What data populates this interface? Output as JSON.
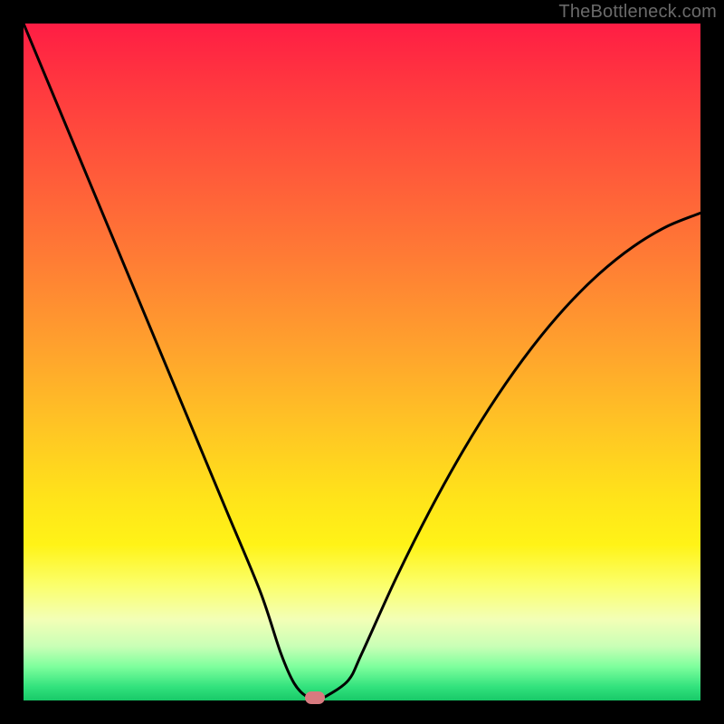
{
  "watermark": "TheBottleneck.com",
  "colors": {
    "frame": "#000000",
    "curve": "#000000",
    "marker": "#d87a7f",
    "gradient_stops": [
      "#ff1d44",
      "#ff3a3f",
      "#ff5a3a",
      "#ff7a35",
      "#ffa22d",
      "#ffc624",
      "#ffe31a",
      "#fff317",
      "#fbff6c",
      "#f3ffb6",
      "#c9ffb6",
      "#7eff9d",
      "#32e27d",
      "#18c968"
    ]
  },
  "chart_data": {
    "type": "line",
    "title": "",
    "xlabel": "",
    "ylabel": "",
    "xlim": [
      0,
      100
    ],
    "ylim": [
      0,
      100
    ],
    "series": [
      {
        "name": "bottleneck-curve",
        "x": [
          0,
          5,
          10,
          15,
          20,
          25,
          30,
          35,
          38,
          40,
          42,
          44,
          45,
          48,
          50,
          55,
          60,
          65,
          70,
          75,
          80,
          85,
          90,
          95,
          100
        ],
        "values": [
          100,
          88,
          76,
          64,
          52,
          40,
          28,
          16,
          7,
          2.5,
          0.5,
          0.5,
          0.8,
          3,
          7,
          18,
          28,
          37,
          45,
          52,
          58,
          63,
          67,
          70,
          72
        ]
      }
    ],
    "marker": {
      "x": 43,
      "y": 0.4
    }
  }
}
